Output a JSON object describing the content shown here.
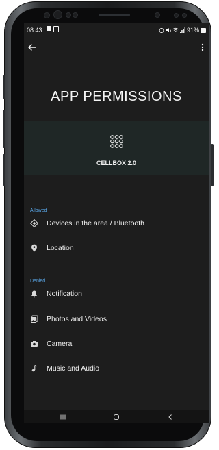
{
  "status_bar": {
    "time": "08:43",
    "right": "91%"
  },
  "page": {
    "title": "APP PERMISSIONS"
  },
  "app": {
    "name": "CELLBOX 2.0",
    "icon": "grid-icon"
  },
  "sections": {
    "allowed": {
      "label": "Allowed",
      "items": [
        {
          "label": "Devices in the area / Bluetooth",
          "icon": "bluetooth-diamond-icon"
        },
        {
          "label": "Location",
          "icon": "location-pin-icon"
        }
      ]
    },
    "denied": {
      "label": "Denied",
      "items": [
        {
          "label": "Notification",
          "icon": "bell-icon"
        },
        {
          "label": "Photos and Videos",
          "icon": "photos-icon"
        },
        {
          "label": "Camera",
          "icon": "camera-icon"
        },
        {
          "label": "Music and Audio",
          "icon": "music-note-icon"
        }
      ]
    }
  },
  "colors": {
    "screen_bg": "#1d1d1d",
    "accent_label": "#5aa7e8",
    "app_card_bg": "#1f2726"
  }
}
